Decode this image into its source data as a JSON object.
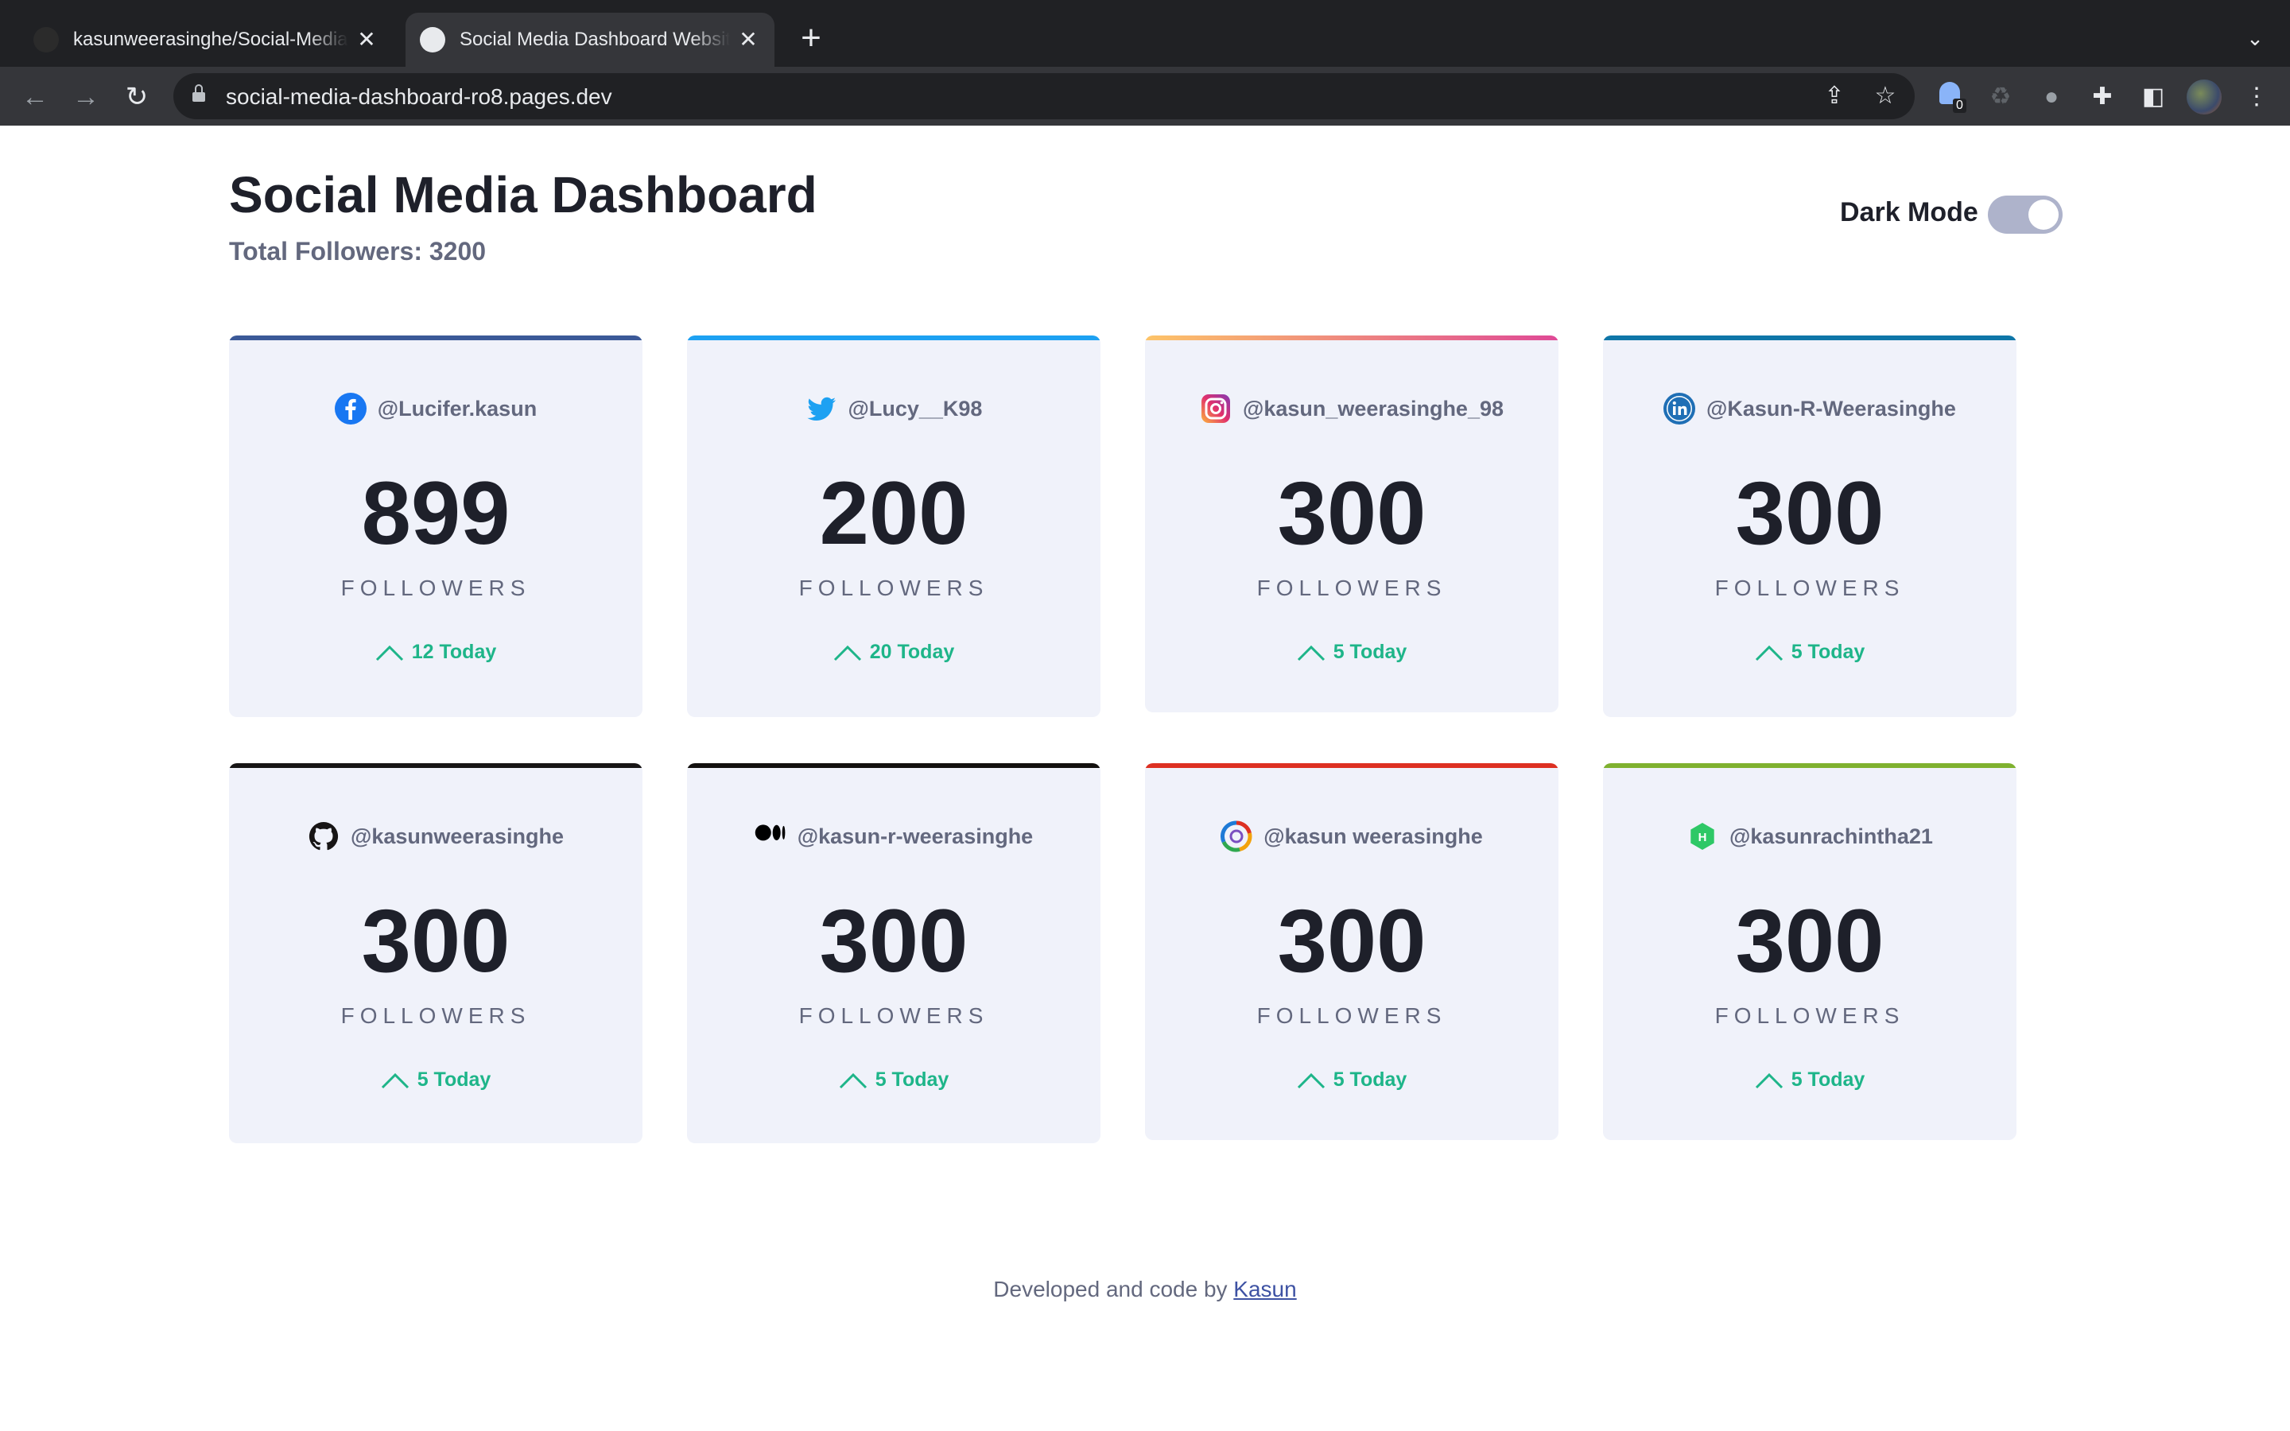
{
  "browser": {
    "tabs": [
      {
        "title": "kasunweerasinghe/Social-Media-Dashboard",
        "active": false
      },
      {
        "title": "Social Media Dashboard Website",
        "active": true
      }
    ],
    "new_tab": "+",
    "url": "social-media-dashboard-ro8.pages.dev",
    "extension_badge": "0"
  },
  "header": {
    "title": "Social Media Dashboard",
    "total_followers": "Total Followers: 3200",
    "dark_mode_label": "Dark Mode",
    "dark_mode_on": false
  },
  "cards": [
    {
      "platform": "facebook-icon",
      "handle": "@Lucifer.kasun",
      "count": "899",
      "label": "FOLLOWERS",
      "today": "12 Today",
      "accent": "#3b5998"
    },
    {
      "platform": "twitter-icon",
      "handle": "@Lucy__K98",
      "count": "200",
      "label": "FOLLOWERS",
      "today": "20 Today",
      "accent": "#1da1f2"
    },
    {
      "platform": "instagram-icon",
      "handle": "@kasun_weerasinghe_98",
      "count": "300",
      "label": "FOLLOWERS",
      "today": "5 Today",
      "accent": "#dc2743"
    },
    {
      "platform": "linkedin-icon",
      "handle": "@Kasun-R-Weerasinghe",
      "count": "300",
      "label": "FOLLOWERS",
      "today": "5 Today",
      "accent": "#0e76a8"
    },
    {
      "platform": "github-icon",
      "handle": "@kasunweerasinghe",
      "count": "300",
      "label": "FOLLOWERS",
      "today": "5 Today",
      "accent": "#171515"
    },
    {
      "platform": "medium-icon",
      "handle": "@kasun-r-weerasinghe",
      "count": "300",
      "label": "FOLLOWERS",
      "today": "5 Today",
      "accent": "#12100e"
    },
    {
      "platform": "stackshare-icon",
      "handle": "@kasun weerasinghe",
      "count": "300",
      "label": "FOLLOWERS",
      "today": "5 Today",
      "accent": "#dd3022"
    },
    {
      "platform": "hackerrank-icon",
      "handle": "@kasunrachintha21",
      "count": "300",
      "label": "FOLLOWERS",
      "today": "5 Today",
      "accent": "#7fb12f"
    }
  ],
  "footer": {
    "text": "Developed and code by",
    "link": "Kasun"
  }
}
